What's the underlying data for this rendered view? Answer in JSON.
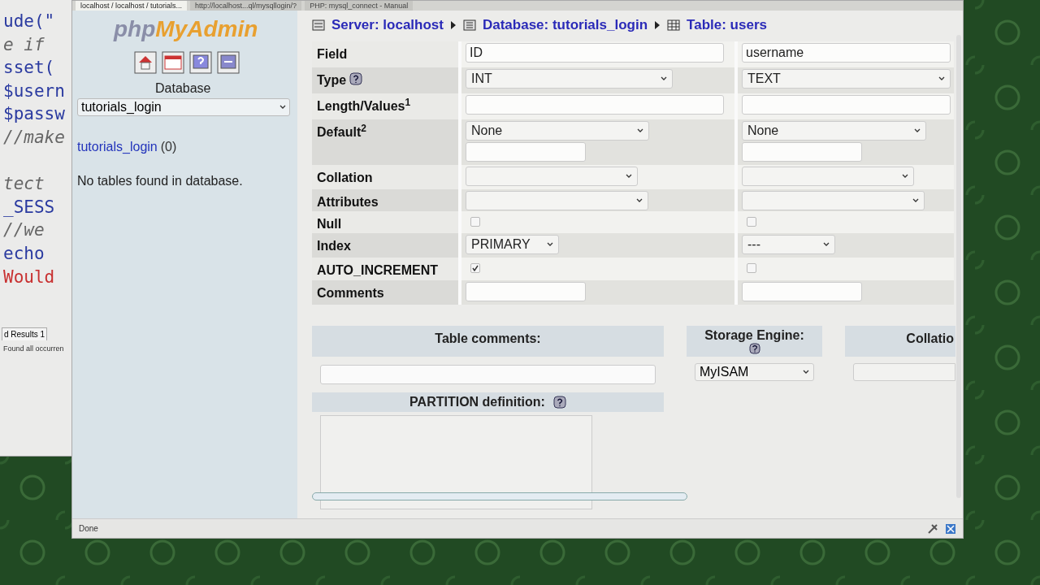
{
  "editor": {
    "code_lines": [
      {
        "text": "ude(\"",
        "kind": "keyword"
      },
      {
        "text": "e if",
        "kind": "comment"
      },
      {
        "text": "sset(",
        "kind": "keyword"
      },
      {
        "text": "$usern",
        "kind": "keyword"
      },
      {
        "text": "$passw",
        "kind": "keyword"
      },
      {
        "text": "//make",
        "kind": "comment"
      },
      {
        "kind": "blank"
      },
      {
        "text": "tect",
        "kind": "comment"
      },
      {
        "text": "_SESS",
        "kind": "keyword"
      },
      {
        "text": "//we",
        "kind": "comment"
      },
      {
        "text": "echo",
        "kind": "keyword"
      },
      {
        "text": "Would",
        "kind": "string"
      }
    ],
    "results_tab": "d Results 1",
    "results_message": "Found all occurren"
  },
  "browser": {
    "tabs": [
      {
        "label": "localhost / localhost / tutorials...",
        "selected": true
      },
      {
        "label": "http://localhost...ql/mysqllogin/?",
        "selected": false
      },
      {
        "label": "PHP: mysql_connect - Manual",
        "selected": false
      }
    ],
    "status": "Done"
  },
  "navigation": {
    "logo_part1": "php",
    "logo_part2": "MyAdmin",
    "database_label": "Database",
    "database_select": "tutorials_login",
    "database_link": "tutorials_login",
    "table_count": "(0)",
    "message": "No tables found in database."
  },
  "breadcrumb": [
    {
      "label": "Server: localhost",
      "kind": "server"
    },
    {
      "label": "Database: tutorials_login",
      "kind": "database"
    },
    {
      "label": "Table: users",
      "kind": "table"
    }
  ],
  "rows": [
    {
      "label": "Field",
      "kind": "text",
      "help": false,
      "cells": [
        {
          "value": "ID"
        },
        {
          "value": "username"
        }
      ]
    },
    {
      "label": "Type",
      "kind": "select",
      "help": true,
      "cells": [
        {
          "value": "INT"
        },
        {
          "value": "TEXT"
        }
      ]
    },
    {
      "label": "Length/Values$^{1}$",
      "kind": "text",
      "help": false,
      "cells": [
        {},
        {}
      ]
    },
    {
      "label": "Default$^{2}$",
      "kind": "select_text",
      "help": false,
      "cells": [
        {
          "value": "None"
        },
        {
          "value": "None"
        }
      ]
    },
    {
      "label": "Collation",
      "kind": "select",
      "help": false,
      "cells": [
        {},
        {}
      ]
    },
    {
      "label": "Attributes",
      "kind": "select",
      "help": false,
      "cells": [
        {},
        {}
      ]
    },
    {
      "label": "Null",
      "kind": "checkbox",
      "help": false,
      "cells": [
        {
          "checked": false
        },
        {
          "checked": false
        }
      ]
    },
    {
      "label": "Index",
      "kind": "select",
      "help": false,
      "cells": [
        {
          "value": "PRIMARY"
        },
        {
          "value": "---"
        }
      ]
    },
    {
      "label": "AUTO_INCREMENT",
      "kind": "checkbox",
      "help": false,
      "cells": [
        {
          "checked": true
        },
        {
          "checked": false
        }
      ]
    },
    {
      "label": "Comments",
      "kind": "text",
      "help": false,
      "cells": [
        {},
        {}
      ]
    }
  ],
  "table_options": {
    "comments_label": "Table comments:",
    "engine_label": "Storage Engine:",
    "engine_value": "MyISAM",
    "collation_label": "Collatio",
    "partition_label": "PARTITION definition:"
  }
}
